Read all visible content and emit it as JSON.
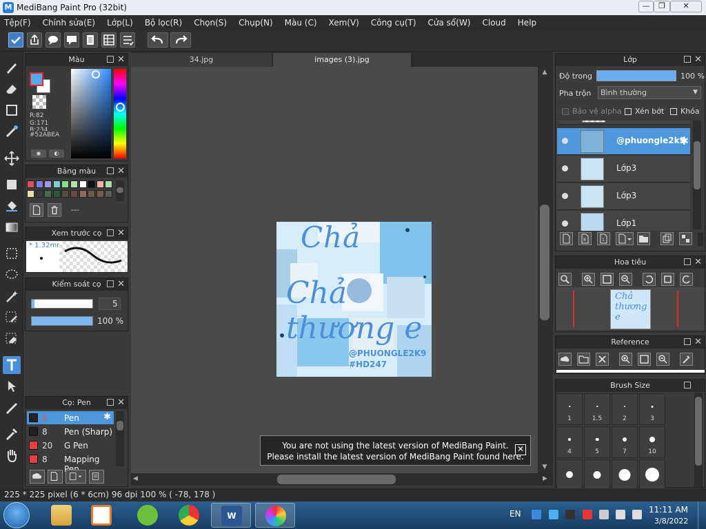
{
  "window": {
    "title": "MediBang Paint Pro (32bit)",
    "min_label": "—",
    "max_label": "❐",
    "close_label": "✕"
  },
  "menu": [
    "Tệp(F)",
    "Chỉnh sửa(E)",
    "Lớp(L)",
    "Bộ lọc(R)",
    "Chọn(S)",
    "Chụp(N)",
    "Màu (C)",
    "Xem(V)",
    "Công cụ(T)",
    "Cửa sổ(W)",
    "Cloud",
    "Help"
  ],
  "tabs": [
    "34.jpg",
    "images (3).jpg"
  ],
  "color_panel": {
    "title": "Màu",
    "r": "R:82",
    "g": "G:171",
    "b": "B:234",
    "hex": "#52ABEA",
    "fg_color": "#52abea"
  },
  "palette_panel": {
    "title": "Bảng màu",
    "colors": [
      "#e0505a",
      "#7d7de8",
      "#9b9bea",
      "#79d1d1",
      "#86e08a",
      "#b8e0a5",
      "#ffffff",
      "#111111",
      "#e8b4a4",
      "#a8e0a8",
      "#e8e0a8",
      "#3a3a3a",
      "#4a6a4a",
      "#2a5a3a",
      "#5a4a3a",
      "#6a4a3a",
      "#8a6a5a",
      "#6a5a4a",
      "#7a5a4a",
      "#5a5a5a"
    ],
    "name": "---"
  },
  "preview_panel": {
    "title": "Xem trước cọ",
    "size": "* 1.32mm"
  },
  "control_panel": {
    "title": "Kiểm soát cọ",
    "size_value": "5",
    "opacity_value": "100 %"
  },
  "brushes_panel": {
    "title": "Cọ: Pen",
    "items": [
      {
        "size": "5",
        "name": "Pen",
        "color": "#222222"
      },
      {
        "size": "8",
        "name": "Pen (Sharp)",
        "color": "#222222"
      },
      {
        "size": "20",
        "name": "G Pen",
        "color": "#e84040"
      },
      {
        "size": "8",
        "name": "Mapping Pen",
        "color": "#e84040"
      }
    ]
  },
  "canvas": {
    "artwork_title": "Chả thương e",
    "artwork_handle": "@PHUONGLE2K9",
    "artwork_tag": "#HD247"
  },
  "toast": {
    "line1": "You are not using the latest version of MediBang Paint.",
    "line2": "Please install the latest version of MediBang Paint found here.",
    "close_label": "✕"
  },
  "layers_panel": {
    "title": "Lớp",
    "opacity_label": "Độ trong",
    "opacity_value": "100 %",
    "blend_label": "Pha trộn",
    "blend_value": "Bình thường",
    "alpha_label": "Bảo vệ alpha",
    "clip_label": "Xén bớt",
    "lock_label": "Khóa",
    "layers": [
      "@phuongle2k9",
      "Lớp3",
      "Lớp3",
      "Lớp1"
    ]
  },
  "navigator_panel": {
    "title": "Hoa tiêu"
  },
  "reference_panel": {
    "title": "Reference"
  },
  "brushsize_panel": {
    "title": "Brush Size",
    "sizes": [
      "1",
      "1.5",
      "2",
      "3",
      "4",
      "5",
      "7",
      "10",
      "",
      "",
      "",
      ""
    ]
  },
  "status": {
    "text": "225 * 225 pixel  (6 * 6cm)  96 dpi  100 %  ( -78, 178 )"
  },
  "taskbar": {
    "lang": "EN",
    "time": "11:11 AM",
    "date": "3/8/2022"
  }
}
